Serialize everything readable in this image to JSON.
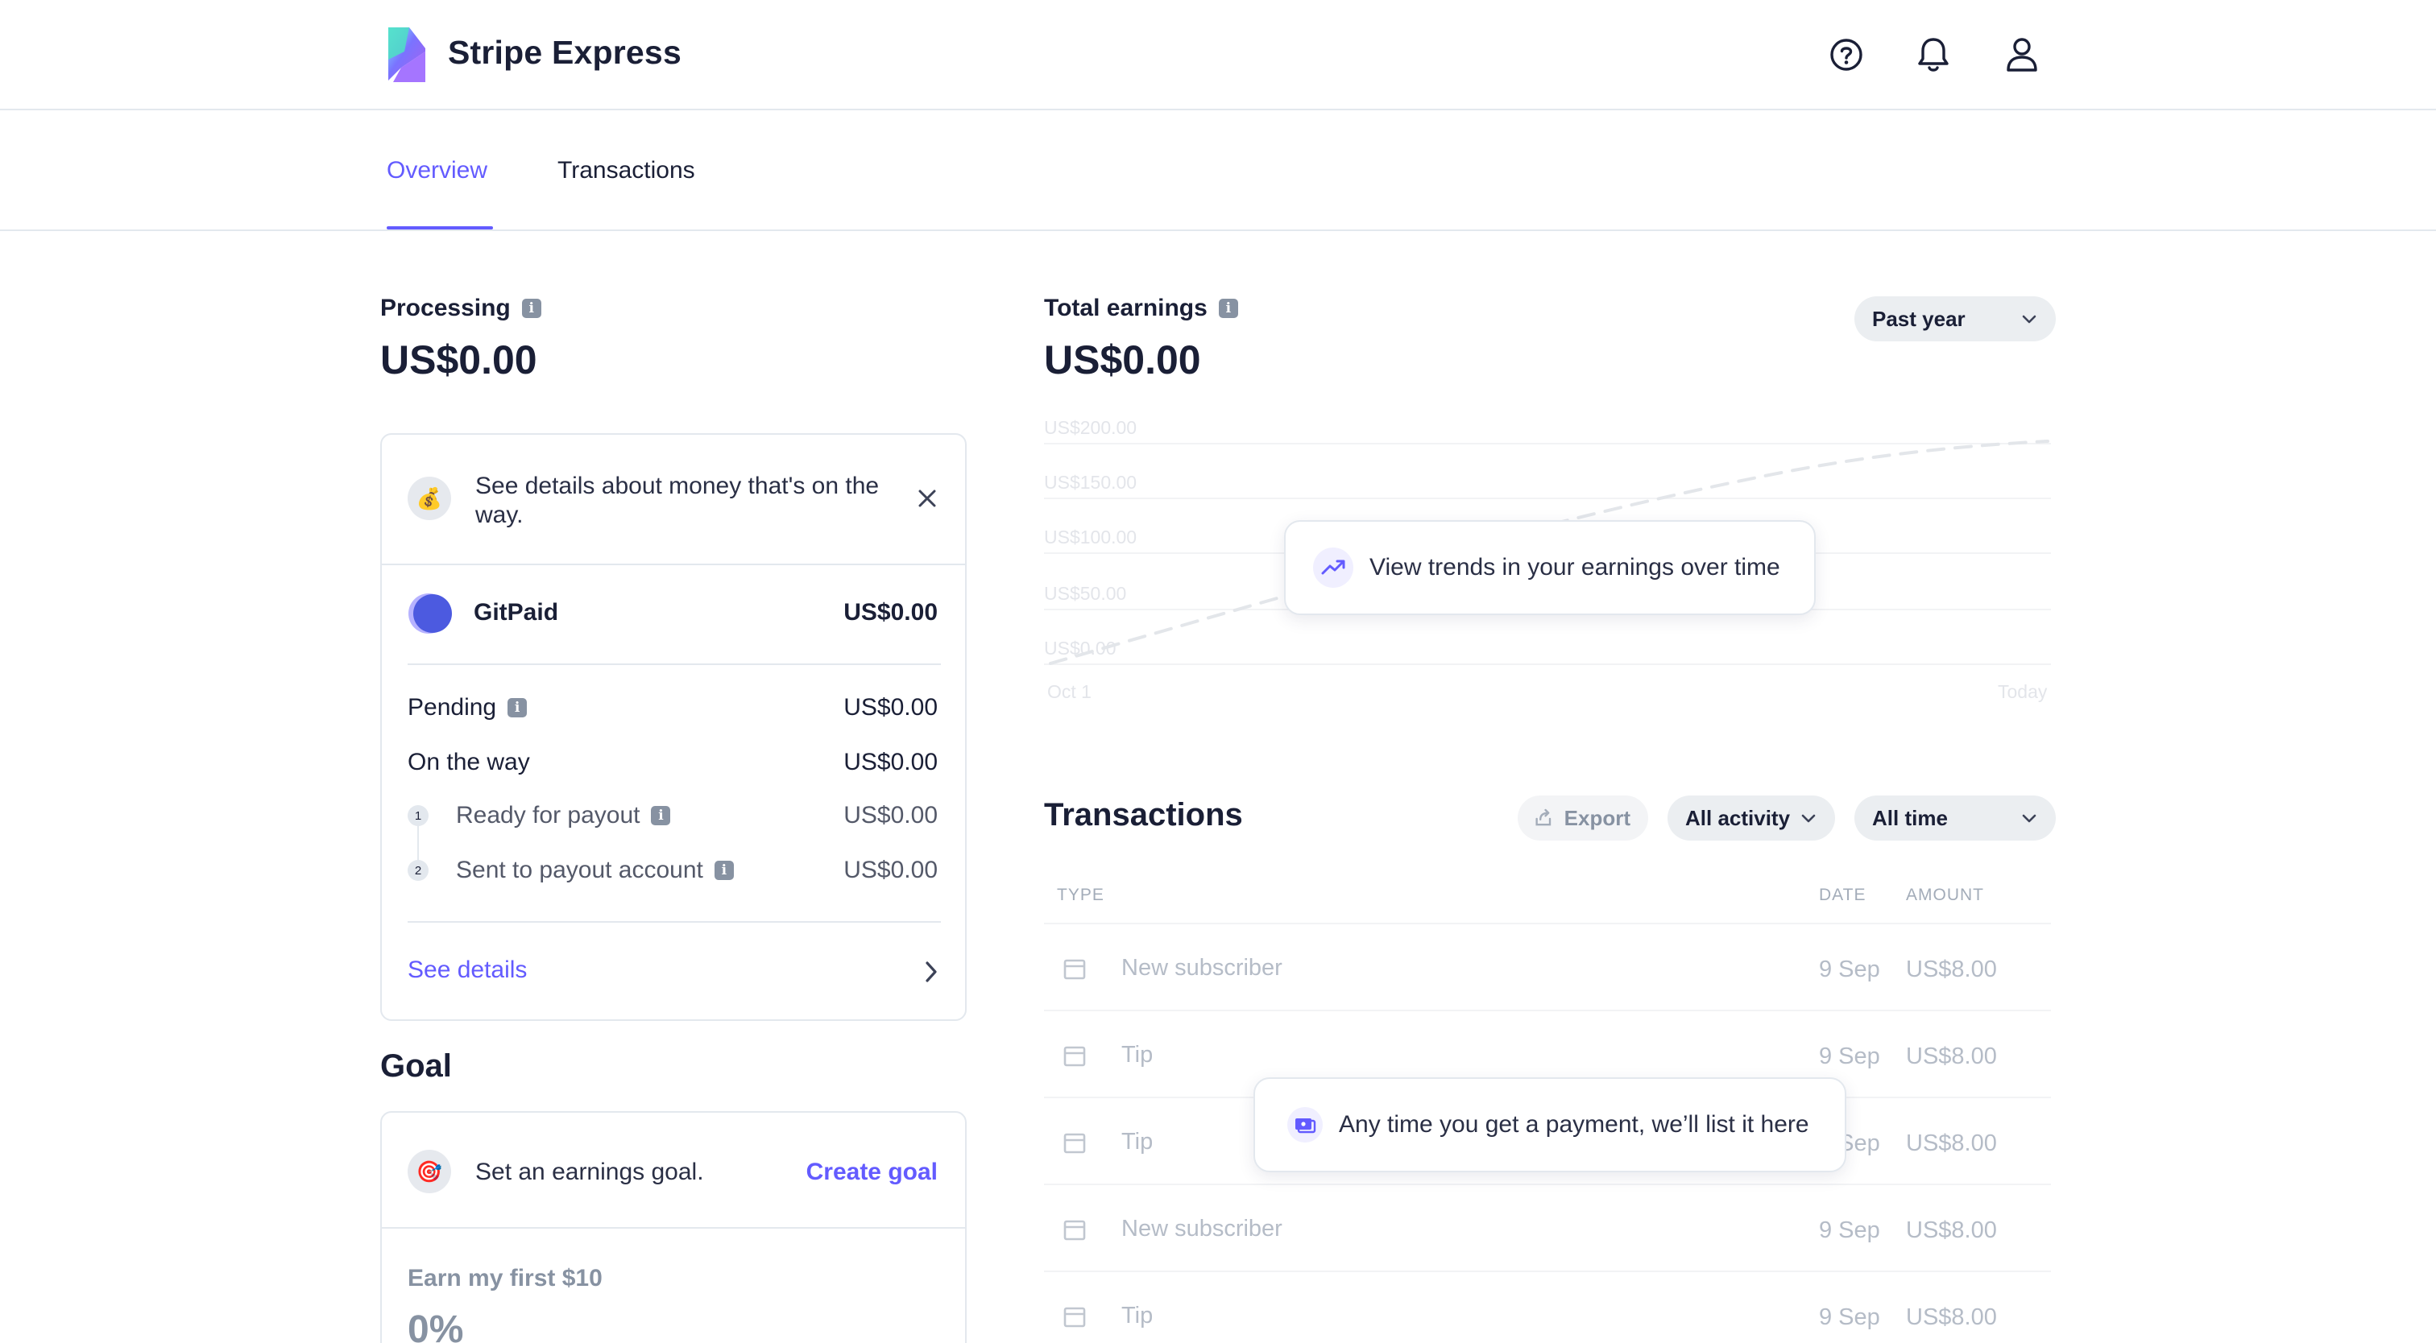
{
  "app": {
    "name": "Stripe Express"
  },
  "header": {
    "icons": [
      "help-icon",
      "bell-icon",
      "user-icon"
    ]
  },
  "tabs": [
    {
      "label": "Overview",
      "active": true
    },
    {
      "label": "Transactions",
      "active": false
    }
  ],
  "processing": {
    "label": "Processing",
    "amount": "US$0.00",
    "notice": "See details about money that's on the way.",
    "account": {
      "name": "GitPaid",
      "amount": "US$0.00"
    },
    "rows": [
      {
        "label": "Pending",
        "value": "US$0.00"
      },
      {
        "label": "On the way",
        "value": "US$0.00"
      },
      {
        "step": "1",
        "label": "Ready for payout",
        "value": "US$0.00"
      },
      {
        "step": "2",
        "label": "Sent to payout account",
        "value": "US$0.00"
      }
    ],
    "see_details": "See details"
  },
  "goal": {
    "title": "Goal",
    "prompt": "Set an earnings goal.",
    "create_label": "Create goal",
    "target_label": "Earn my first $10",
    "percent": "0%"
  },
  "earnings": {
    "label": "Total earnings",
    "amount": "US$0.00",
    "range": "Past year",
    "tooltip": "View trends in your earnings over time"
  },
  "chart_data": {
    "type": "line",
    "title": "",
    "y_ticks": [
      "US$200.00",
      "US$150.00",
      "US$100.00",
      "US$50.00",
      "US$0.00"
    ],
    "x_labels": [
      "Oct 1",
      "Today"
    ],
    "ylim": [
      0,
      200
    ],
    "note_placeholder": true
  },
  "transactions": {
    "title": "Transactions",
    "export_label": "Export",
    "filter_activity": "All activity",
    "filter_time": "All time",
    "columns": {
      "type": "TYPE",
      "date": "DATE",
      "amount": "AMOUNT"
    },
    "rows": [
      {
        "type": "New subscriber",
        "date": "9 Sep",
        "amount": "US$8.00"
      },
      {
        "type": "Tip",
        "date": "9 Sep",
        "amount": "US$8.00"
      },
      {
        "type": "Tip",
        "date": "9 Sep",
        "amount": "US$8.00"
      },
      {
        "type": "New subscriber",
        "date": "9 Sep",
        "amount": "US$8.00"
      },
      {
        "type": "Tip",
        "date": "9 Sep",
        "amount": "US$8.00"
      }
    ],
    "tooltip": "Any time you get a payment, we’ll list it here"
  },
  "colors": {
    "accent": "#635bff",
    "text": "#1a1f36",
    "muted": "#545969",
    "border": "#e3e8ee"
  }
}
